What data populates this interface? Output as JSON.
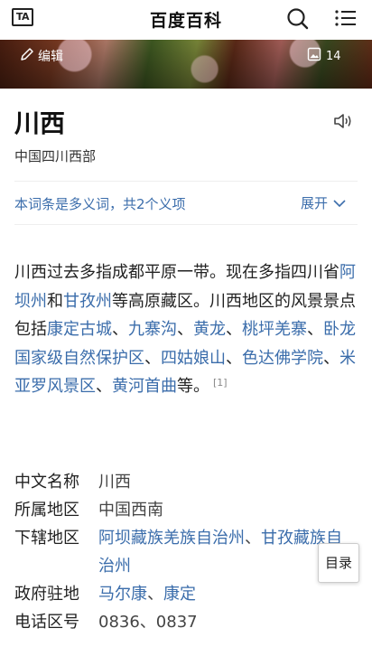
{
  "header": {
    "ta_label": "TA",
    "logo": "百度百科",
    "icons": {
      "search": "search-icon",
      "menu": "menu-list-icon"
    }
  },
  "banner": {
    "edit_label": "编辑",
    "image_count": "14",
    "icons": {
      "edit": "pencil-icon",
      "gallery": "image-gallery-icon"
    }
  },
  "entry": {
    "title": "川西",
    "subtitle": "中国四川西部",
    "speaker_icon": "speaker-icon"
  },
  "polysemy": {
    "text": "本词条是多义词，共2个义项",
    "expand_label": "展开"
  },
  "summary": {
    "t1": "川西过去多指成都平原一带。现在多指四川省",
    "l1": "阿坝州",
    "t2": "和",
    "l2": "甘孜州",
    "t3": "等高原藏区。川西地区的风景景点包括",
    "l3": "康定古城",
    "s1": "、",
    "l4": "九寨沟",
    "s2": "、",
    "l5": "黄龙",
    "s3": "、",
    "l6": "桃坪羌寨",
    "s4": "、",
    "l7": "卧龙国家级自然保护区",
    "s5": "、",
    "l8": "四姑娘山",
    "s6": "、",
    "l9": "色达佛学院",
    "s7": "、",
    "l10": "米亚罗风景区",
    "s8": "、",
    "l11": "黄河首曲",
    "t4": "等。",
    "ref": "[1]"
  },
  "basic_info": {
    "chinese_name_label": "中文名称",
    "chinese_name": "川西",
    "region_label": "所属地区",
    "region": "中国西南",
    "subdivisions_label": "下辖地区",
    "sub1": "阿坝藏族羌族自治州",
    "sub_sep": "、",
    "sub2": "甘孜藏族自治州",
    "seat_label": "政府驻地",
    "seat1": "马尔康",
    "seat_sep": "、",
    "seat2": "康定",
    "area_code_label": "电话区号",
    "area_code": "0836、0837"
  },
  "toc_label": "目录",
  "colors": {
    "link": "#3b6dab",
    "text": "#222222"
  }
}
